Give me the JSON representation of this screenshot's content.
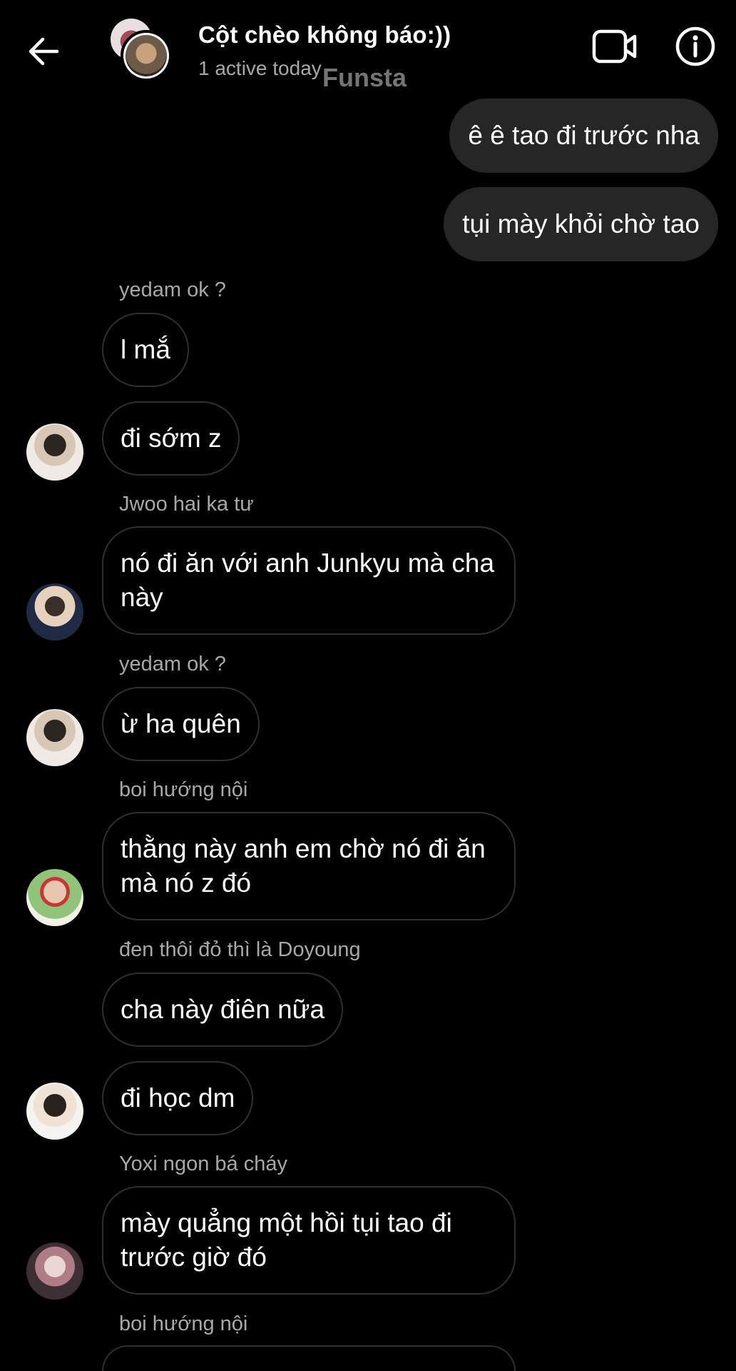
{
  "header": {
    "title": "Cột chèo không báo:))",
    "status": "1 active today",
    "watermark": "Funsta",
    "back_icon": "arrow-left-icon",
    "video_icon": "video-camera-icon",
    "info_icon": "info-icon"
  },
  "messages": {
    "sent": [
      "ê ê tao đi trước nha",
      "tụi mày khỏi chờ tao"
    ],
    "senders": [
      "yedam ok ?",
      "Jwoo hai ka tư",
      "yedam ok ?",
      "boi hướng nội",
      "đen thôi đỏ thì là Doyoung",
      "Yoxi ngon bá cháy",
      "boi hướng nội"
    ],
    "received": [
      "l mắ",
      "đi sớm z",
      "nó đi ăn với anh Junkyu mà cha này",
      "ừ ha quên",
      "thằng này anh em chờ nó đi ăn mà nó z đó",
      "cha này điên nữa",
      "đi học dm",
      "mày quẳng một hồi tụi tao đi trước giờ đó"
    ]
  },
  "colors": {
    "background": "#000000",
    "sent_bubble": "#262626",
    "received_border": "#2f2f2f",
    "secondary_text": "#a8a8a8"
  }
}
